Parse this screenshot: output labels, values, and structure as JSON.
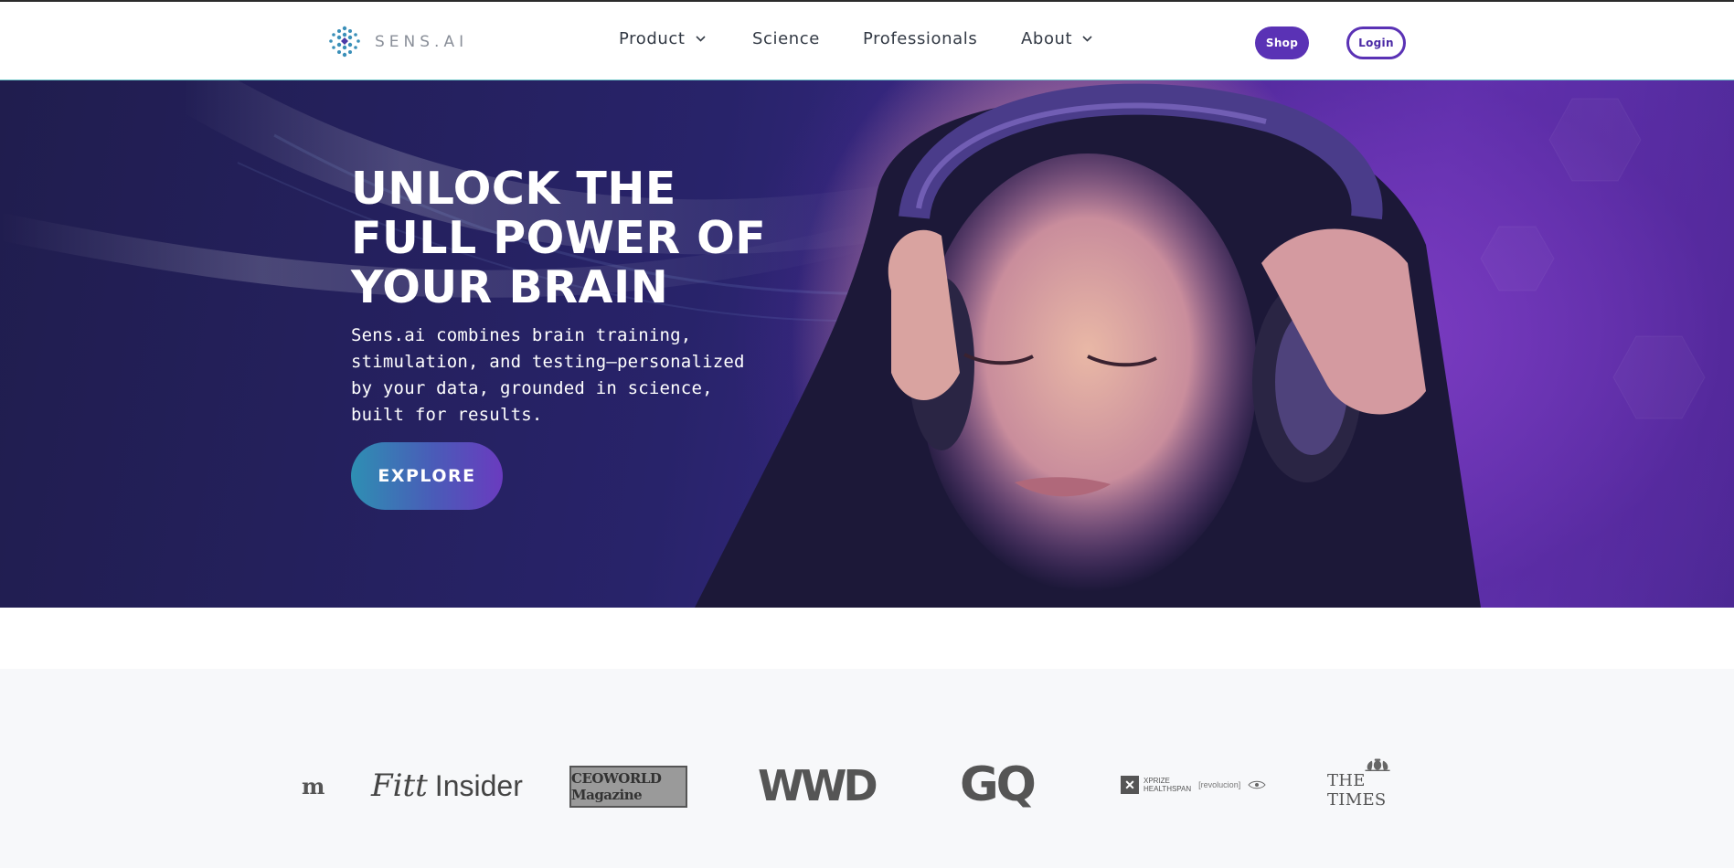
{
  "header": {
    "logo_text": "SENS.AI",
    "nav": [
      {
        "label": "Product",
        "has_dropdown": true
      },
      {
        "label": "Science",
        "has_dropdown": false
      },
      {
        "label": "Professionals",
        "has_dropdown": false
      },
      {
        "label": "About",
        "has_dropdown": true
      }
    ],
    "shop_label": "Shop",
    "login_label": "Login"
  },
  "hero": {
    "title_lines": [
      "UNLOCK THE",
      "FULL POWER OF",
      "YOUR BRAIN"
    ],
    "subtitle": "Sens.ai combines brain training, stimulation, and testing—personalized by your data, grounded in science, built for results.",
    "cta_label": "EXPLORE"
  },
  "press": {
    "logos": [
      {
        "name": "partial-logo",
        "text": "m"
      },
      {
        "name": "fitt-insider",
        "text_a": "Fitt",
        "text_b": "Insider"
      },
      {
        "name": "ceoworld-magazine",
        "text": "CEOWORLD Magazine"
      },
      {
        "name": "wwd",
        "text": "WWD"
      },
      {
        "name": "gq",
        "text": "GQ"
      },
      {
        "name": "xprize-healthspan",
        "line1": "XPRIZE",
        "line2": "HEALTHSPAN",
        "tag": "[revolucion]"
      },
      {
        "name": "the-times",
        "text": "THE TIMES"
      }
    ]
  },
  "colors": {
    "brand_purple": "#5a32b5",
    "hero_dark": "#201d4e",
    "cta_teal": "#2e8fb3",
    "press_bg": "#f7f8fa"
  }
}
